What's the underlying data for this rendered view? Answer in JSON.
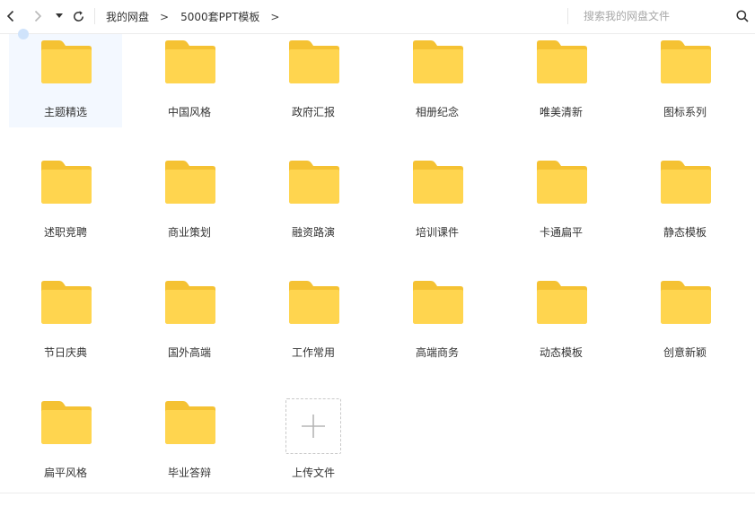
{
  "toolbar": {
    "breadcrumb": [
      "我的网盘",
      "5000套PPT模板"
    ],
    "breadcrumb_separator": ">",
    "search_placeholder": "搜索我的网盘文件"
  },
  "folders": [
    {
      "name": "主题精选",
      "selected": true
    },
    {
      "name": "中国风格"
    },
    {
      "name": "政府汇报"
    },
    {
      "name": "相册纪念"
    },
    {
      "name": "唯美清新"
    },
    {
      "name": "图标系列"
    },
    {
      "name": "述职竞聘"
    },
    {
      "name": "商业策划"
    },
    {
      "name": "融资路演"
    },
    {
      "name": "培训课件"
    },
    {
      "name": "卡通扁平"
    },
    {
      "name": "静态模板"
    },
    {
      "name": "节日庆典"
    },
    {
      "name": "国外高端"
    },
    {
      "name": "工作常用"
    },
    {
      "name": "高端商务"
    },
    {
      "name": "动态模板"
    },
    {
      "name": "创意新颖"
    },
    {
      "name": "扁平风格"
    },
    {
      "name": "毕业答辩"
    }
  ],
  "upload": {
    "label": "上传文件"
  },
  "colors": {
    "folder_back": "#F5C233",
    "folder_front": "#FFD54F",
    "selected_bg": "#F3F8FF",
    "accent": "#4A90E2"
  }
}
